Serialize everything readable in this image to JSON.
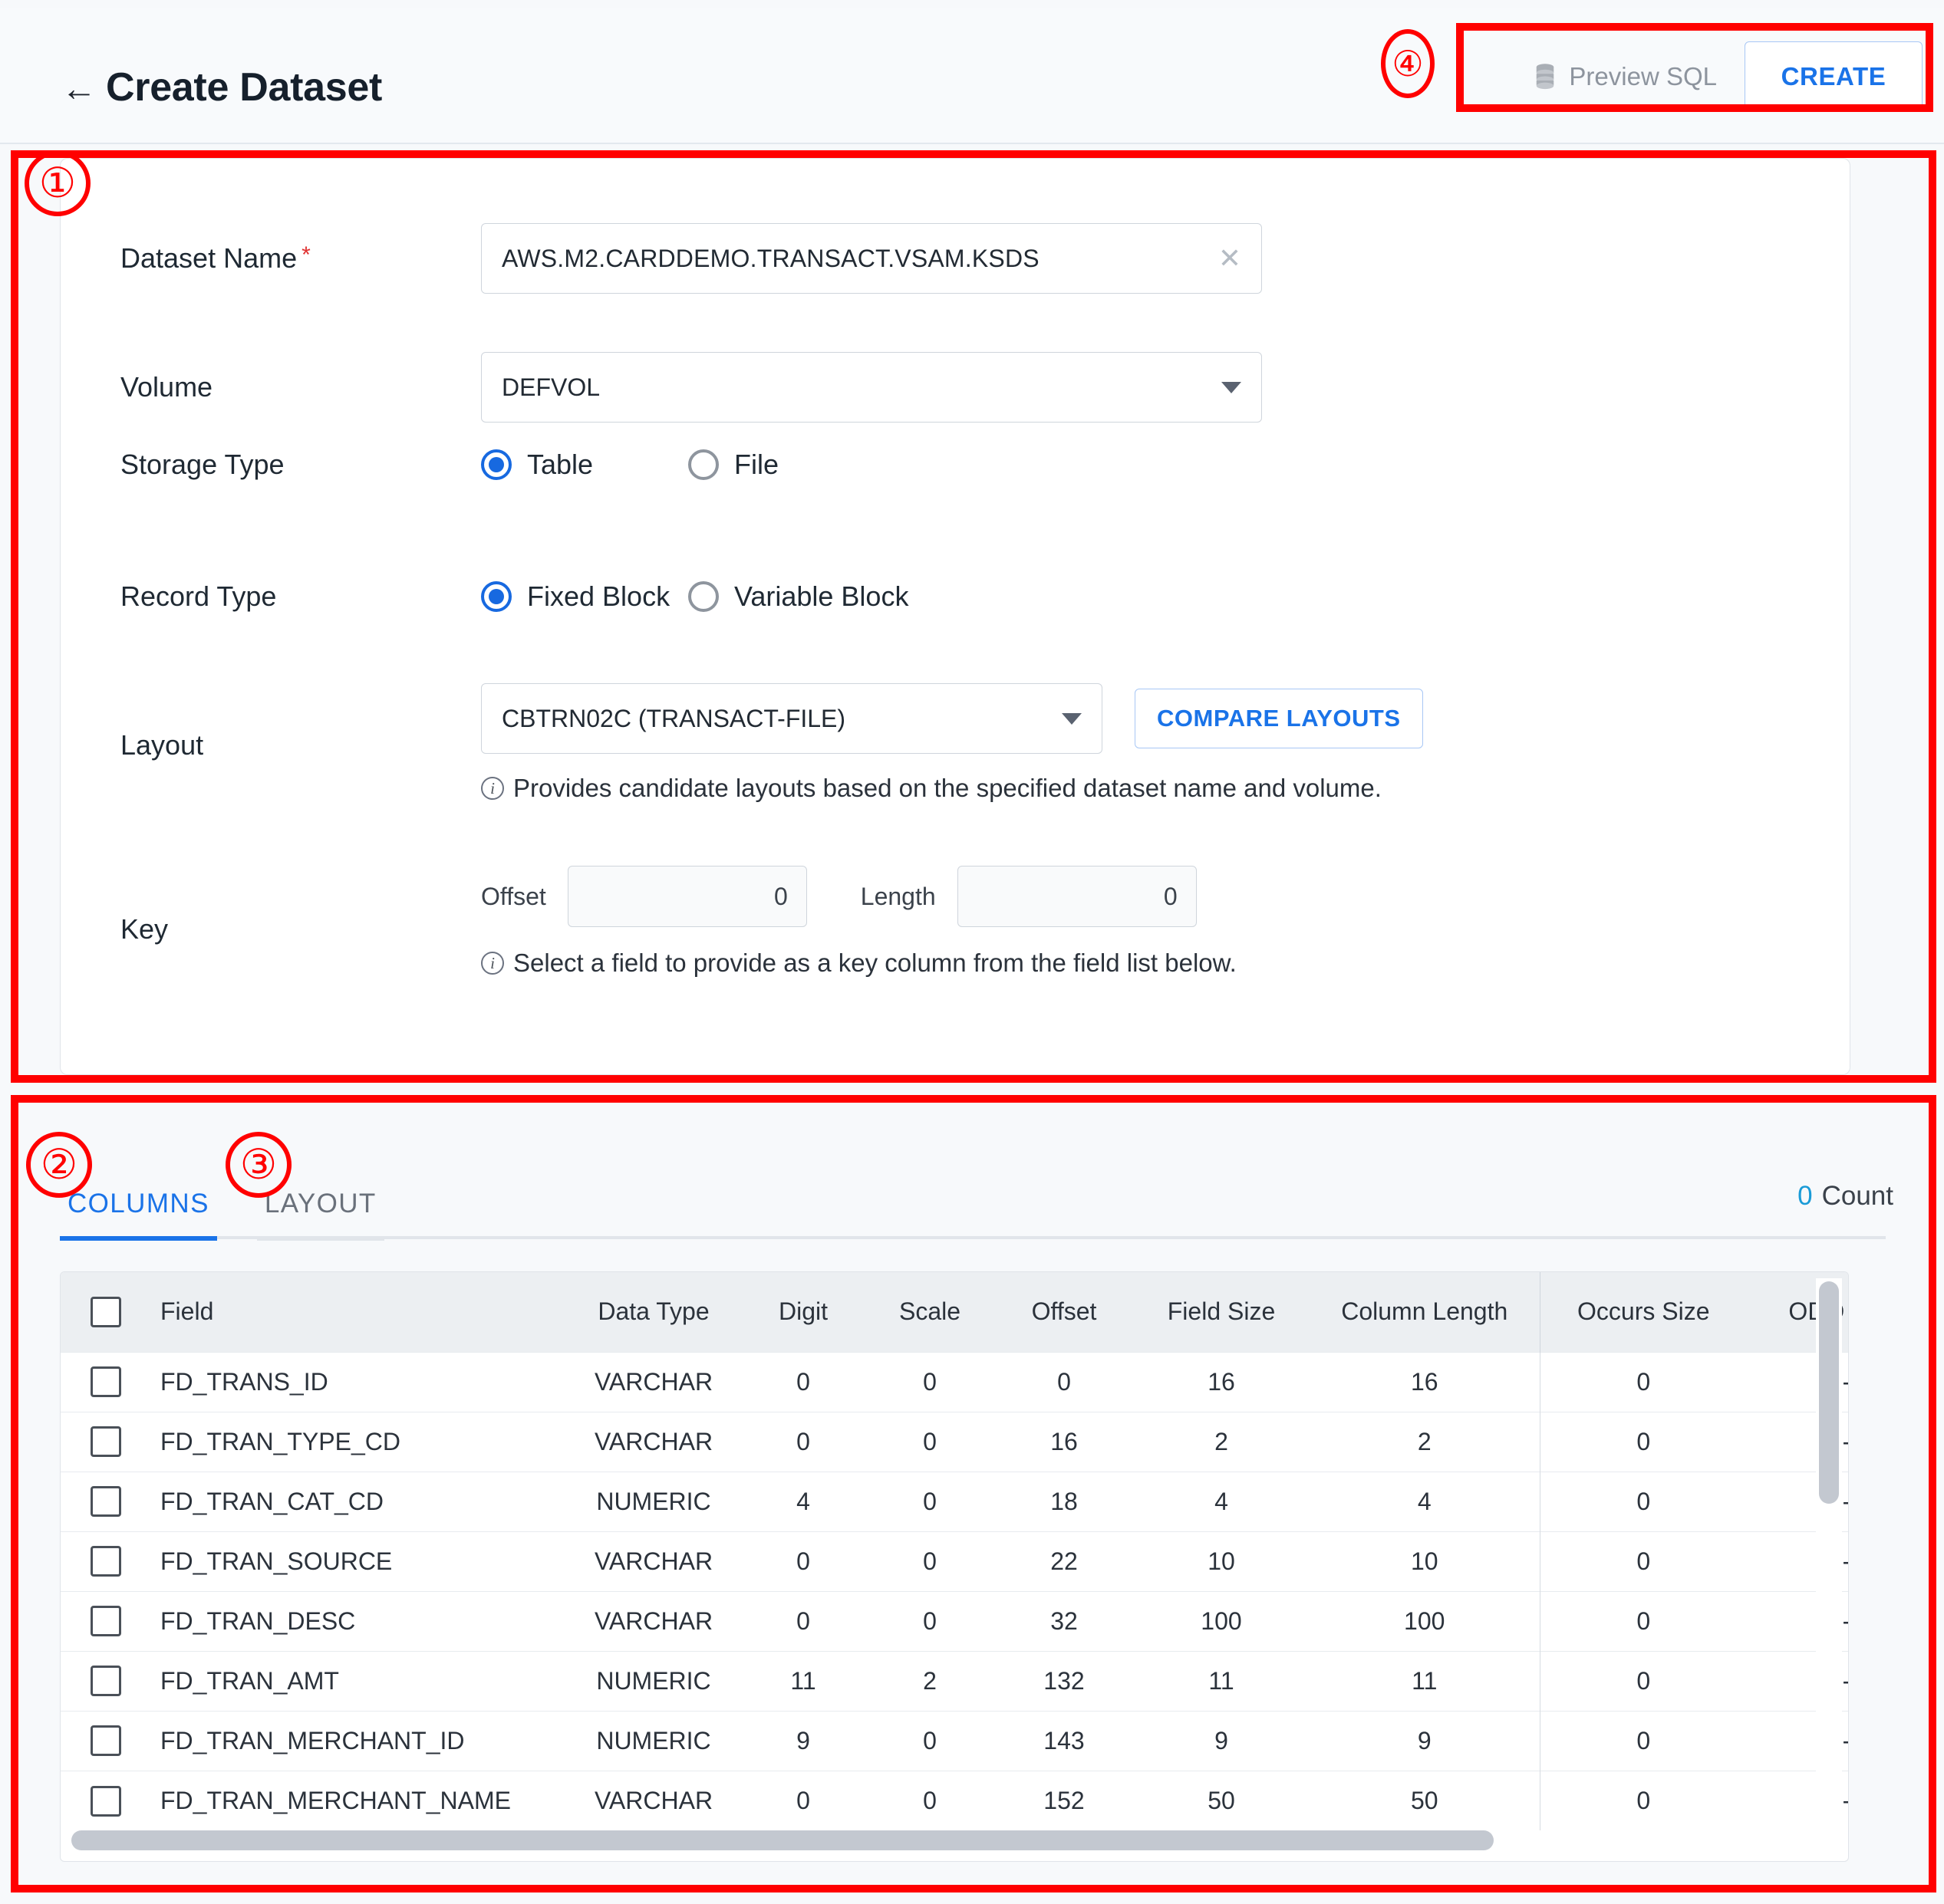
{
  "header": {
    "back_icon": "arrow-left-icon",
    "title": "Create Dataset",
    "preview_sql_label": "Preview SQL",
    "preview_sql_icon": "database-icon",
    "create_label": "CREATE",
    "accent_color": "#1a73e8"
  },
  "annotations": {
    "one": "①",
    "two": "②",
    "three": "③",
    "four": "④",
    "color": "#ff0000"
  },
  "form": {
    "dataset_name": {
      "label": "Dataset Name",
      "required_mark": "*",
      "value": "AWS.M2.CARDDEMO.TRANSACT.VSAM.KSDS",
      "placeholder": "Dataset Name",
      "clear_icon": "close-icon"
    },
    "volume": {
      "label": "Volume",
      "value": "DEFVOL"
    },
    "storage_type": {
      "label": "Storage Type",
      "options": [
        "Table",
        "File"
      ],
      "selected": "Table"
    },
    "record_type": {
      "label": "Record Type",
      "options": [
        "Fixed Block",
        "Variable Block"
      ],
      "selected": "Fixed Block"
    },
    "layout": {
      "label": "Layout",
      "value": "CBTRN02C (TRANSACT-FILE)",
      "compare_button": "COMPARE LAYOUTS",
      "hint": "Provides candidate layouts based on the specified dataset name and volume."
    },
    "key": {
      "label": "Key",
      "offset_label": "Offset",
      "offset_value": "0",
      "length_label": "Length",
      "length_value": "0",
      "hint": "Select a field to provide as a key column from the field list below."
    }
  },
  "tabs": {
    "items": [
      {
        "label": "COLUMNS",
        "active": true
      },
      {
        "label": "LAYOUT",
        "active": false
      }
    ],
    "count_value": "0",
    "count_label": "Count"
  },
  "table": {
    "headers": [
      "Field",
      "Data Type",
      "Digit",
      "Scale",
      "Offset",
      "Field Size",
      "Column Length",
      "Occurs Size",
      "ODO Field"
    ],
    "rows": [
      {
        "field": "FD_TRANS_ID",
        "data_type": "VARCHAR",
        "digit": "0",
        "scale": "0",
        "offset": "0",
        "field_size": "16",
        "column_length": "16",
        "occurs_size": "0",
        "odo_field": "-"
      },
      {
        "field": "FD_TRAN_TYPE_CD",
        "data_type": "VARCHAR",
        "digit": "0",
        "scale": "0",
        "offset": "16",
        "field_size": "2",
        "column_length": "2",
        "occurs_size": "0",
        "odo_field": "-"
      },
      {
        "field": "FD_TRAN_CAT_CD",
        "data_type": "NUMERIC",
        "digit": "4",
        "scale": "0",
        "offset": "18",
        "field_size": "4",
        "column_length": "4",
        "occurs_size": "0",
        "odo_field": "-"
      },
      {
        "field": "FD_TRAN_SOURCE",
        "data_type": "VARCHAR",
        "digit": "0",
        "scale": "0",
        "offset": "22",
        "field_size": "10",
        "column_length": "10",
        "occurs_size": "0",
        "odo_field": "-"
      },
      {
        "field": "FD_TRAN_DESC",
        "data_type": "VARCHAR",
        "digit": "0",
        "scale": "0",
        "offset": "32",
        "field_size": "100",
        "column_length": "100",
        "occurs_size": "0",
        "odo_field": "-"
      },
      {
        "field": "FD_TRAN_AMT",
        "data_type": "NUMERIC",
        "digit": "11",
        "scale": "2",
        "offset": "132",
        "field_size": "11",
        "column_length": "11",
        "occurs_size": "0",
        "odo_field": "-"
      },
      {
        "field": "FD_TRAN_MERCHANT_ID",
        "data_type": "NUMERIC",
        "digit": "9",
        "scale": "0",
        "offset": "143",
        "field_size": "9",
        "column_length": "9",
        "occurs_size": "0",
        "odo_field": "-"
      },
      {
        "field": "FD_TRAN_MERCHANT_NAME",
        "data_type": "VARCHAR",
        "digit": "0",
        "scale": "0",
        "offset": "152",
        "field_size": "50",
        "column_length": "50",
        "occurs_size": "0",
        "odo_field": "-"
      }
    ]
  }
}
